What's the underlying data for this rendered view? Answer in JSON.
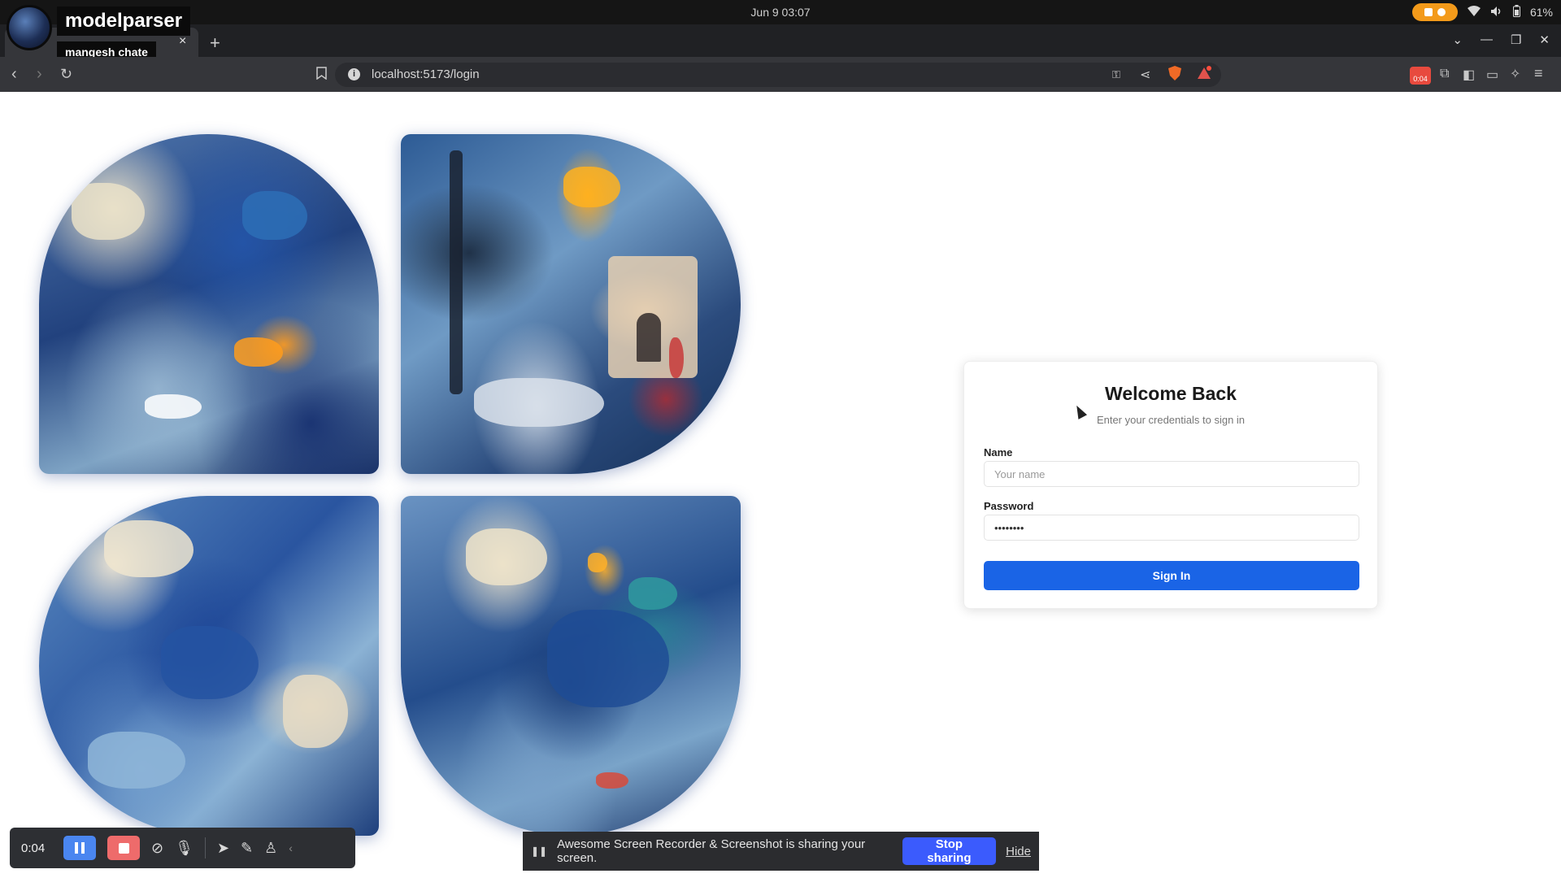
{
  "os": {
    "clock": "Jun 9  03:07",
    "battery": "61%",
    "icons": [
      "recording-indicator-icon",
      "wifi-icon",
      "volume-icon",
      "battery-icon"
    ]
  },
  "recorder_overlay": {
    "channel_name": "modelparser",
    "user_name": "mangesh chate"
  },
  "browser": {
    "url": "localhost:5173/login",
    "extension_badge": "0:04",
    "tab_close": "×",
    "new_tab": "+"
  },
  "login": {
    "title": "Welcome Back",
    "subtitle": "Enter your credentials to sign in",
    "name_label": "Name",
    "name_placeholder": "Your name",
    "name_value": "",
    "password_label": "Password",
    "password_value": "••••••••",
    "submit_label": "Sign In"
  },
  "recorder_bar": {
    "elapsed": "0:04"
  },
  "sharing_bar": {
    "message": "Awesome Screen Recorder & Screenshot is sharing your screen.",
    "stop_label": "Stop sharing",
    "hide_label": "Hide"
  },
  "colors": {
    "primary_button": "#1a64e6",
    "stop_sharing": "#3b5bfd",
    "recorder_pause": "#4a86f0",
    "recorder_stop": "#ee6b6b",
    "record_pill": "#f39a1a"
  }
}
